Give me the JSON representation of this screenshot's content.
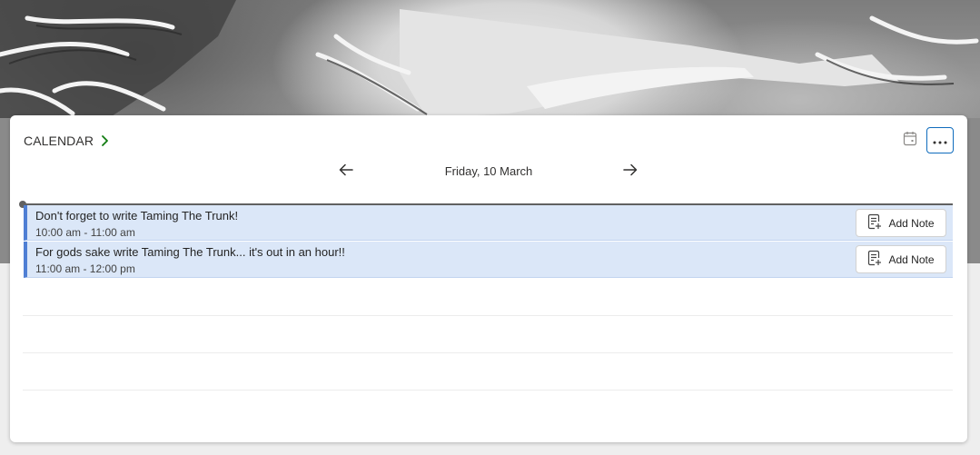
{
  "header": {
    "title": "CALENDAR"
  },
  "nav": {
    "date": "Friday, 10 March"
  },
  "events": [
    {
      "title": "Don't forget to write Taming The Trunk!",
      "time": "10:00 am - 11:00 am",
      "action_label": "Add Note"
    },
    {
      "title": "For gods sake write Taming The Trunk... it's out in an hour!!",
      "time": "11:00 am - 12:00 pm",
      "action_label": "Add Note"
    }
  ],
  "icons": {
    "title_chevron": "chevron-right-icon",
    "calendar": "calendar-icon",
    "more": "more-horizontal-icon",
    "prev": "arrow-left-icon",
    "next": "arrow-right-icon",
    "note": "note-add-icon"
  },
  "colors": {
    "accent": "#0f6cbd",
    "chevron": "#107c10",
    "event_bg": "#dbe7f8",
    "event_border": "#4f7fd4"
  }
}
